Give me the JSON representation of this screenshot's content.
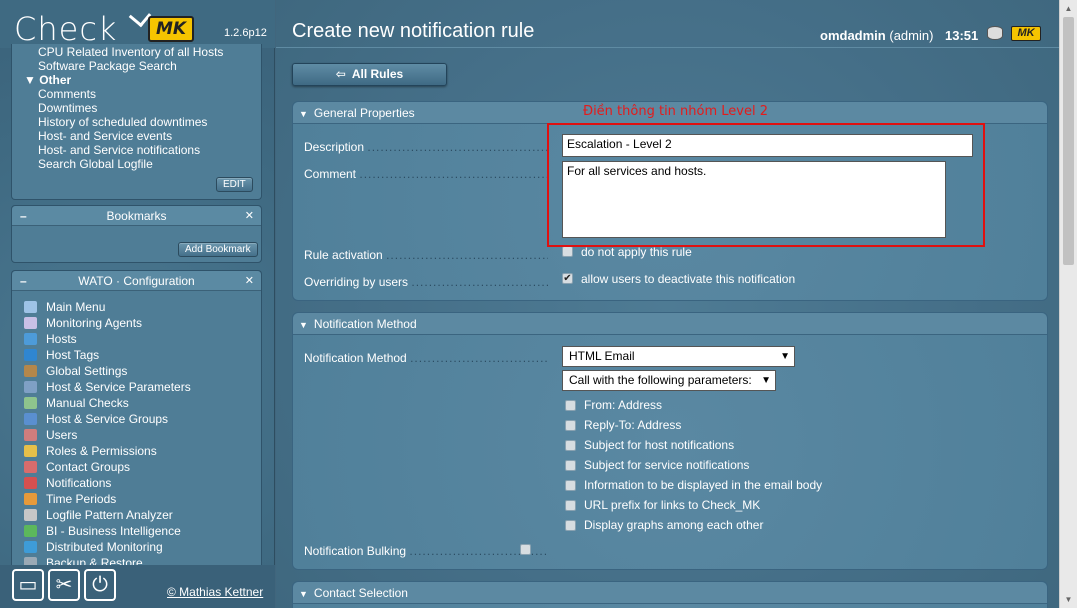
{
  "sidebar": {
    "logo_text": "Check",
    "logo_badge": "MK",
    "version": "1.2.6p12",
    "views": {
      "items": [
        {
          "label": "CPU Related Inventory of all Hosts",
          "section": false
        },
        {
          "label": "Software Package Search",
          "section": false
        },
        {
          "label": "Other",
          "section": true
        },
        {
          "label": "Comments",
          "section": false
        },
        {
          "label": "Downtimes",
          "section": false
        },
        {
          "label": "History of scheduled downtimes",
          "section": false
        },
        {
          "label": "Host- and Service events",
          "section": false
        },
        {
          "label": "Host- and Service notifications",
          "section": false
        },
        {
          "label": "Search Global Logfile",
          "section": false
        }
      ],
      "edit_label": "EDIT"
    },
    "bookmarks": {
      "title": "Bookmarks",
      "add_label": "Add Bookmark"
    },
    "wato": {
      "title": "WATO · Configuration",
      "items": [
        {
          "label": "Main Menu",
          "icon": "home-icon",
          "color": "#9ec3e6"
        },
        {
          "label": "Monitoring Agents",
          "icon": "agent-icon",
          "color": "#c9c0e6"
        },
        {
          "label": "Hosts",
          "icon": "folder-icon",
          "color": "#4d9bd9"
        },
        {
          "label": "Host Tags",
          "icon": "tag-icon",
          "color": "#2f86d1"
        },
        {
          "label": "Global Settings",
          "icon": "settings-icon",
          "color": "#b4874b"
        },
        {
          "label": "Host & Service Parameters",
          "icon": "rules-icon",
          "color": "#7fa0c5"
        },
        {
          "label": "Manual Checks",
          "icon": "check-icon",
          "color": "#8ec48d"
        },
        {
          "label": "Host & Service Groups",
          "icon": "groups-icon",
          "color": "#5a8fd0"
        },
        {
          "label": "Users",
          "icon": "users-icon",
          "color": "#d07d7d"
        },
        {
          "label": "Roles & Permissions",
          "icon": "roles-icon",
          "color": "#e6c04a"
        },
        {
          "label": "Contact Groups",
          "icon": "contact-groups-icon",
          "color": "#d86c6c"
        },
        {
          "label": "Notifications",
          "icon": "notifications-icon",
          "color": "#d65050"
        },
        {
          "label": "Time Periods",
          "icon": "clock-icon",
          "color": "#e79a3a"
        },
        {
          "label": "Logfile Pattern Analyzer",
          "icon": "logfile-icon",
          "color": "#c7c7c7"
        },
        {
          "label": "BI - Business Intelligence",
          "icon": "bi-icon",
          "color": "#5cb85c"
        },
        {
          "label": "Distributed Monitoring",
          "icon": "distributed-icon",
          "color": "#3e9cd8"
        },
        {
          "label": "Backup & Restore",
          "icon": "backup-icon",
          "color": "#9aa9b5"
        }
      ]
    },
    "copyright": "© Mathias Kettner"
  },
  "header": {
    "title": "Create new notification rule",
    "user": "omdadmin",
    "role": "(admin)",
    "time": "13:51",
    "badge": "MK"
  },
  "toolbar": {
    "all_rules_label": "All Rules"
  },
  "general": {
    "title": "General Properties",
    "annotation": "Điền thông tin nhóm Level 2",
    "description_label": "Description",
    "description_value": "Escalation - Level 2",
    "comment_label": "Comment",
    "comment_value": "For all services and hosts.",
    "rule_activation_label": "Rule activation",
    "rule_activation_option": "do not apply this rule",
    "overriding_label": "Overriding by users",
    "overriding_option": "allow users to deactivate this notification"
  },
  "method": {
    "title": "Notification Method",
    "method_label": "Notification Method",
    "method_value": "HTML Email",
    "params_value": "Call with the following parameters:",
    "options": [
      "From: Address",
      "Reply-To: Address",
      "Subject for host notifications",
      "Subject for service notifications",
      "Information to be displayed in the email body",
      "URL prefix for links to Check_MK",
      "Display graphs among each other"
    ],
    "bulking_label": "Notification Bulking"
  },
  "contact": {
    "title": "Contact Selection"
  }
}
